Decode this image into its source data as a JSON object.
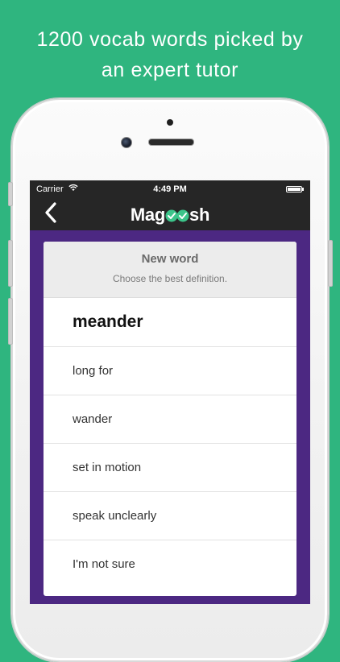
{
  "headline": {
    "line1": "1200 vocab words picked by",
    "line2": "an expert tutor"
  },
  "status_bar": {
    "carrier": "Carrier",
    "time": "4:49 PM"
  },
  "nav": {
    "logo_left": "Mag",
    "logo_right": "sh"
  },
  "quiz": {
    "title": "New word",
    "instruction": "Choose the best definition.",
    "word": "meander",
    "options": [
      "long for",
      "wander",
      "set in motion",
      "speak unclearly",
      "I'm not sure"
    ]
  },
  "colors": {
    "background": "#2fb57f",
    "screen_purple": "#4c2882",
    "nav_dark": "#262626",
    "logo_check": "#3cc48a"
  }
}
